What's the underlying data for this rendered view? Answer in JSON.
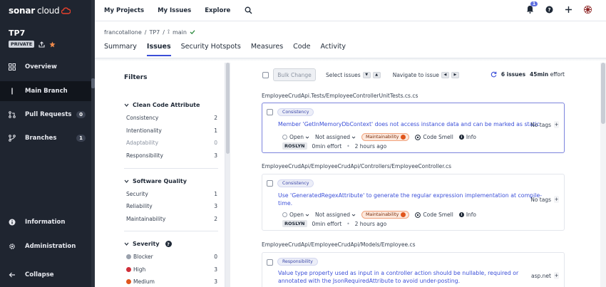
{
  "app": {
    "logo_bold": "sonar",
    "logo_light": "cloud"
  },
  "sidebar": {
    "project_name": "TP7",
    "private_badge": "PRIVATE",
    "items": [
      {
        "label": "Overview",
        "icon": "overview-icon"
      },
      {
        "label": "Main Branch",
        "icon": "branch-icon",
        "active": true
      },
      {
        "label": "Pull Requests",
        "icon": "pull-request-icon",
        "count": "0"
      },
      {
        "label": "Branches",
        "icon": "branches-icon",
        "count": "1"
      },
      {
        "label": "Information",
        "icon": "info-icon"
      },
      {
        "label": "Administration",
        "icon": "gear-icon"
      },
      {
        "label": "Collapse",
        "icon": "arrow-left-icon"
      }
    ]
  },
  "topnav": {
    "links": [
      "My Projects",
      "My Issues",
      "Explore"
    ],
    "notification_count": "1"
  },
  "breadcrumb": {
    "org": "francotallone",
    "project": "TP7",
    "branch": "main"
  },
  "tabs": [
    "Summary",
    "Issues",
    "Security Hotspots",
    "Measures",
    "Code",
    "Activity"
  ],
  "filters": {
    "title": "Filters",
    "groups": [
      {
        "title": "Clean Code Attribute",
        "rows": [
          {
            "label": "Consistency",
            "count": "2"
          },
          {
            "label": "Intentionality",
            "count": "1"
          },
          {
            "label": "Adaptability",
            "count": "0"
          },
          {
            "label": "Responsibility",
            "count": "3"
          }
        ]
      },
      {
        "title": "Software Quality",
        "rows": [
          {
            "label": "Security",
            "count": "1"
          },
          {
            "label": "Reliability",
            "count": "3"
          },
          {
            "label": "Maintainability",
            "count": "2"
          }
        ]
      },
      {
        "title": "Severity",
        "rows": [
          {
            "label": "Blocker",
            "count": "0"
          },
          {
            "label": "High",
            "count": "3"
          },
          {
            "label": "Medium",
            "count": "3"
          }
        ]
      }
    ]
  },
  "toolbar": {
    "bulk_change": "Bulk Change",
    "select_issues": "Select issues",
    "navigate_to_issue": "Navigate to issue",
    "issues_count": "6 issues",
    "effort": "45min",
    "effort_label": "effort"
  },
  "issues": [
    {
      "file": "EmployeeCrudApi.Tests/EmployeeControllerUnitTests.cs.cs",
      "attribute": "Consistency",
      "message_lines": [
        "Member 'GetInMemoryDbContext' does not access instance data and can be marked as static"
      ],
      "tags": "No tags",
      "status": "Open",
      "assignee": "Not assigned",
      "quality": "Maintainability",
      "type": "Code Smell",
      "severity": "Info",
      "engine": "ROSLYN",
      "effort": "0min effort",
      "age": "2 hours ago"
    },
    {
      "file": "EmployeeCrudApi/EmployeeCrudApi/Controllers/EmployeeController.cs",
      "attribute": "Consistency",
      "message_lines": [
        "Use 'GeneratedRegexAttribute' to generate the regular expression implementation at compile-",
        "time."
      ],
      "tags": "No tags",
      "status": "Open",
      "assignee": "Not assigned",
      "quality": "Maintainability",
      "type": "Code Smell",
      "severity": "Info",
      "engine": "ROSLYN",
      "effort": "0min effort",
      "age": "2 hours ago"
    },
    {
      "file": "EmployeeCrudApi/EmployeeCrudApi/Models/Employee.cs",
      "attribute": "Responsibility",
      "message_lines": [
        "Value type property used as input in a controller action should be nullable, required or",
        "annotated with the JsonRequiredAttribute to avoid under-posting."
      ],
      "tags": "asp.net"
    }
  ],
  "colors": {
    "sidebar_bg": "#1f2530",
    "accent": "#3b4fd8",
    "maintainability": "#e0561d"
  }
}
